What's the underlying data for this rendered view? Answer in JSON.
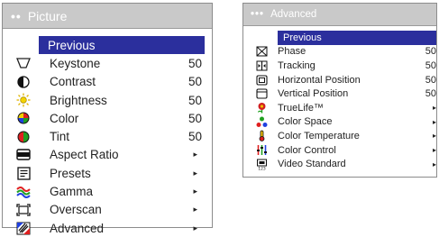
{
  "picture_menu": {
    "dots": "••",
    "title": "Picture",
    "previous": "Previous",
    "items": [
      {
        "label": "Keystone",
        "value": "50",
        "icon": "keystone-icon"
      },
      {
        "label": "Contrast",
        "value": "50",
        "icon": "contrast-icon"
      },
      {
        "label": "Brightness",
        "value": "50",
        "icon": "brightness-icon"
      },
      {
        "label": "Color",
        "value": "50",
        "icon": "color-icon"
      },
      {
        "label": "Tint",
        "value": "50",
        "icon": "tint-icon"
      },
      {
        "label": "Aspect Ratio",
        "value": "▸",
        "icon": "aspect-ratio-icon"
      },
      {
        "label": "Presets",
        "value": "▸",
        "icon": "presets-icon"
      },
      {
        "label": "Gamma",
        "value": "▸",
        "icon": "gamma-icon"
      },
      {
        "label": "Overscan",
        "value": "▸",
        "icon": "overscan-icon"
      },
      {
        "label": "Advanced",
        "value": "▸",
        "icon": "advanced-icon"
      }
    ]
  },
  "advanced_menu": {
    "dots": "•••",
    "title": "Advanced",
    "previous": "Previous",
    "items": [
      {
        "label": "Phase",
        "value": "50",
        "icon": "phase-icon"
      },
      {
        "label": "Tracking",
        "value": "50",
        "icon": "tracking-icon"
      },
      {
        "label": "Horizontal Position",
        "value": "50",
        "icon": "horizontal-position-icon"
      },
      {
        "label": "Vertical Position",
        "value": "50",
        "icon": "vertical-position-icon"
      },
      {
        "label": "TrueLife™",
        "value": "▸",
        "icon": "truelife-icon"
      },
      {
        "label": "Color Space",
        "value": "▸",
        "icon": "color-space-icon"
      },
      {
        "label": "Color Temperature",
        "value": "▸",
        "icon": "color-temperature-icon"
      },
      {
        "label": "Color Control",
        "value": "▸",
        "icon": "color-control-icon"
      },
      {
        "label": "Video Standard",
        "value": "▸",
        "icon": "video-standard-icon"
      }
    ]
  },
  "colors": {
    "title_bar": "#c9c9c9",
    "selected": "#2b2f9d",
    "text": "#222222"
  }
}
